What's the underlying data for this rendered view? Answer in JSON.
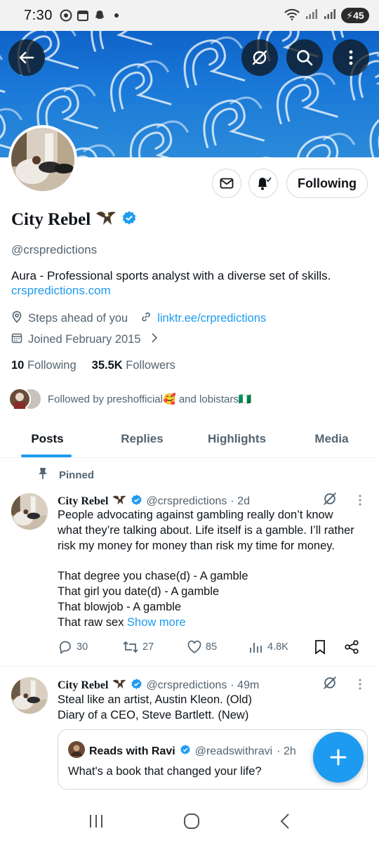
{
  "status_bar": {
    "time": "7:30",
    "battery": "45"
  },
  "banner": {
    "color": "#1a79d8"
  },
  "profile": {
    "display_name": "City Rebel",
    "handle": "@crspredictions",
    "bio": "Aura - Professional sports analyst with a diverse set of skills.",
    "bio_link": "crspredictions.com",
    "location": "Steps ahead of you",
    "website": "linktr.ee/crpredictions",
    "joined": "Joined February 2015",
    "following_count": "10",
    "following_label": "Following",
    "followers_count": "35.5K",
    "followers_label": "Followers",
    "followed_by": "Followed by preshofficial🥰 and lobistars🇳🇬",
    "follow_button": "Following"
  },
  "tabs": [
    {
      "label": "Posts",
      "active": true
    },
    {
      "label": "Replies",
      "active": false
    },
    {
      "label": "Highlights",
      "active": false
    },
    {
      "label": "Media",
      "active": false
    }
  ],
  "posts": [
    {
      "pinned_label": "Pinned",
      "name": "City Rebel",
      "handle": "@crspredictions",
      "time": "· 2d",
      "text_lines": [
        "People advocating against gambling really don’t know",
        "what they’re talking about. Life itself is a gamble. I’ll rather",
        "risk my money for money than risk my time for money.",
        "",
        "That degree you chase(d) - A gamble",
        "That girl you date(d) - A gamble",
        "That blowjob - A gamble",
        "That raw sex"
      ],
      "show_more": "Show more",
      "replies": "30",
      "reposts": "27",
      "likes": "85",
      "views": "4.8K"
    },
    {
      "name": "City Rebel",
      "handle": "@crspredictions",
      "time": "· 49m",
      "text_lines": [
        "Steal like an artist, Austin Kleon. (Old)",
        "Diary of a CEO, Steve Bartlett. (New)"
      ],
      "quote": {
        "name": "Reads with Ravi",
        "handle": "@readswithravi",
        "time": "· 2h",
        "text": "What's a book that changed your life?"
      }
    }
  ],
  "colors": {
    "accent": "#1d9bf0",
    "text_primary": "#0f1419",
    "text_secondary": "#536471"
  }
}
